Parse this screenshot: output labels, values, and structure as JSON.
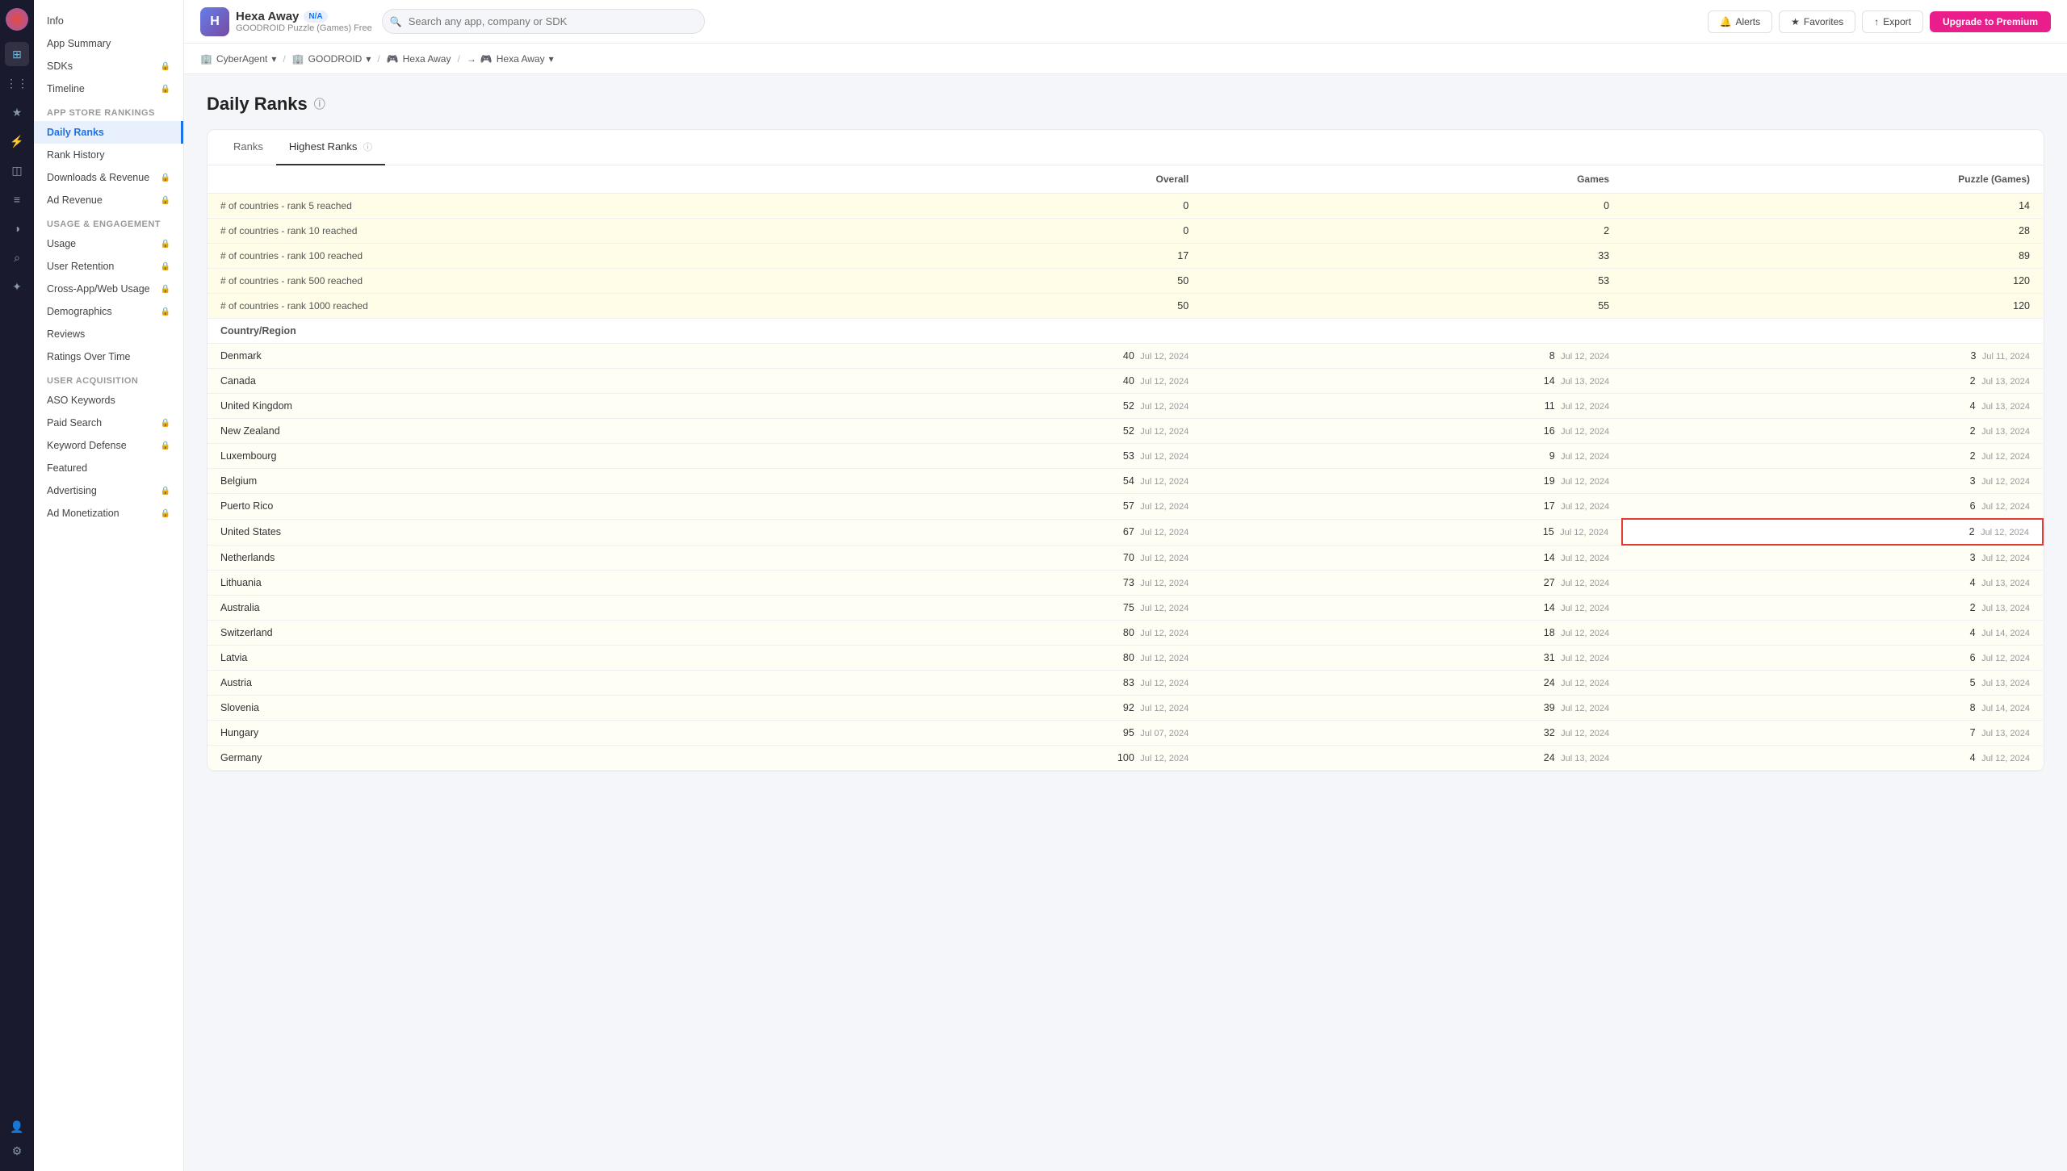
{
  "app": {
    "name": "Hexa Away",
    "sub": "GOODROID Puzzle (Games) Free",
    "na_label": "N/A",
    "icon_char": "H"
  },
  "topbar": {
    "search_placeholder": "Search any app, company or SDK",
    "alerts_label": "Alerts",
    "favorites_label": "Favorites",
    "export_label": "Export",
    "premium_label": "Upgrade to Premium"
  },
  "breadcrumbs": [
    {
      "label": "CyberAgent",
      "icon": "🏢"
    },
    {
      "label": "GOODROID",
      "icon": "🏢"
    },
    {
      "label": "Hexa Away",
      "icon": "🎮"
    },
    {
      "label": "Hexa Away",
      "icon": "🎮"
    }
  ],
  "sidebar": {
    "sections": [
      {
        "label": "",
        "items": [
          {
            "label": "Info",
            "lock": false,
            "active": false
          },
          {
            "label": "App Summary",
            "lock": false,
            "active": false
          }
        ]
      },
      {
        "label": "App Store Rankings",
        "items": [
          {
            "label": "Daily Ranks",
            "lock": false,
            "active": true
          },
          {
            "label": "Rank History",
            "lock": false,
            "active": false
          },
          {
            "label": "Downloads & Revenue",
            "lock": true,
            "active": false
          },
          {
            "label": "Ad Revenue",
            "lock": true,
            "active": false
          }
        ]
      },
      {
        "label": "Usage & Engagement",
        "items": [
          {
            "label": "Usage",
            "lock": true,
            "active": false
          },
          {
            "label": "User Retention",
            "lock": true,
            "active": false
          },
          {
            "label": "Cross-App/Web Usage",
            "lock": true,
            "active": false
          },
          {
            "label": "Demographics",
            "lock": true,
            "active": false
          },
          {
            "label": "Reviews",
            "lock": false,
            "active": false
          },
          {
            "label": "Ratings Over Time",
            "lock": false,
            "active": false
          }
        ]
      },
      {
        "label": "User Acquisition",
        "items": [
          {
            "label": "ASO Keywords",
            "lock": false,
            "active": false
          },
          {
            "label": "Paid Search",
            "lock": true,
            "active": false
          },
          {
            "label": "Keyword Defense",
            "lock": true,
            "active": false
          },
          {
            "label": "Featured",
            "lock": false,
            "active": false
          },
          {
            "label": "Advertising",
            "lock": true,
            "active": false
          },
          {
            "label": "Ad Monetization",
            "lock": true,
            "active": false
          }
        ]
      }
    ]
  },
  "page": {
    "title": "Daily Ranks",
    "tabs": [
      {
        "label": "Ranks",
        "active": false
      },
      {
        "label": "Highest Ranks",
        "active": true
      }
    ]
  },
  "table": {
    "columns": [
      {
        "label": "Overall"
      },
      {
        "label": "Games"
      },
      {
        "label": "Puzzle (Games)"
      }
    ],
    "summary_rows": [
      {
        "label": "# of countries - rank 5 reached",
        "overall": "0",
        "games": "0",
        "puzzle": "14"
      },
      {
        "label": "# of countries - rank 10 reached",
        "overall": "0",
        "games": "2",
        "puzzle": "28"
      },
      {
        "label": "# of countries - rank 100 reached",
        "overall": "17",
        "games": "33",
        "puzzle": "89"
      },
      {
        "label": "# of countries - rank 500 reached",
        "overall": "50",
        "games": "53",
        "puzzle": "120"
      },
      {
        "label": "# of countries - rank 1000 reached",
        "overall": "50",
        "games": "55",
        "puzzle": "120"
      }
    ],
    "section_label": "Country/Region",
    "country_rows": [
      {
        "country": "Denmark",
        "overall": "40",
        "overall_date": "Jul 12, 2024",
        "games": "8",
        "games_date": "Jul 12, 2024",
        "puzzle": "3",
        "puzzle_date": "Jul 11, 2024",
        "highlight": false
      },
      {
        "country": "Canada",
        "overall": "40",
        "overall_date": "Jul 12, 2024",
        "games": "14",
        "games_date": "Jul 13, 2024",
        "puzzle": "2",
        "puzzle_date": "Jul 13, 2024",
        "highlight": false
      },
      {
        "country": "United Kingdom",
        "overall": "52",
        "overall_date": "Jul 12, 2024",
        "games": "11",
        "games_date": "Jul 12, 2024",
        "puzzle": "4",
        "puzzle_date": "Jul 13, 2024",
        "highlight": false
      },
      {
        "country": "New Zealand",
        "overall": "52",
        "overall_date": "Jul 12, 2024",
        "games": "16",
        "games_date": "Jul 12, 2024",
        "puzzle": "2",
        "puzzle_date": "Jul 13, 2024",
        "highlight": false
      },
      {
        "country": "Luxembourg",
        "overall": "53",
        "overall_date": "Jul 12, 2024",
        "games": "9",
        "games_date": "Jul 12, 2024",
        "puzzle": "2",
        "puzzle_date": "Jul 12, 2024",
        "highlight": false
      },
      {
        "country": "Belgium",
        "overall": "54",
        "overall_date": "Jul 12, 2024",
        "games": "19",
        "games_date": "Jul 12, 2024",
        "puzzle": "3",
        "puzzle_date": "Jul 12, 2024",
        "highlight": false
      },
      {
        "country": "Puerto Rico",
        "overall": "57",
        "overall_date": "Jul 12, 2024",
        "games": "17",
        "games_date": "Jul 12, 2024",
        "puzzle": "6",
        "puzzle_date": "Jul 12, 2024",
        "highlight": false
      },
      {
        "country": "United States",
        "overall": "67",
        "overall_date": "Jul 12, 2024",
        "games": "15",
        "games_date": "Jul 12, 2024",
        "puzzle": "2",
        "puzzle_date": "Jul 12, 2024",
        "highlight": true
      },
      {
        "country": "Netherlands",
        "overall": "70",
        "overall_date": "Jul 12, 2024",
        "games": "14",
        "games_date": "Jul 12, 2024",
        "puzzle": "3",
        "puzzle_date": "Jul 12, 2024",
        "highlight": false
      },
      {
        "country": "Lithuania",
        "overall": "73",
        "overall_date": "Jul 12, 2024",
        "games": "27",
        "games_date": "Jul 12, 2024",
        "puzzle": "4",
        "puzzle_date": "Jul 13, 2024",
        "highlight": false
      },
      {
        "country": "Australia",
        "overall": "75",
        "overall_date": "Jul 12, 2024",
        "games": "14",
        "games_date": "Jul 12, 2024",
        "puzzle": "2",
        "puzzle_date": "Jul 13, 2024",
        "highlight": false
      },
      {
        "country": "Switzerland",
        "overall": "80",
        "overall_date": "Jul 12, 2024",
        "games": "18",
        "games_date": "Jul 12, 2024",
        "puzzle": "4",
        "puzzle_date": "Jul 14, 2024",
        "highlight": false
      },
      {
        "country": "Latvia",
        "overall": "80",
        "overall_date": "Jul 12, 2024",
        "games": "31",
        "games_date": "Jul 12, 2024",
        "puzzle": "6",
        "puzzle_date": "Jul 12, 2024",
        "highlight": false
      },
      {
        "country": "Austria",
        "overall": "83",
        "overall_date": "Jul 12, 2024",
        "games": "24",
        "games_date": "Jul 12, 2024",
        "puzzle": "5",
        "puzzle_date": "Jul 13, 2024",
        "highlight": false
      },
      {
        "country": "Slovenia",
        "overall": "92",
        "overall_date": "Jul 12, 2024",
        "games": "39",
        "games_date": "Jul 12, 2024",
        "puzzle": "8",
        "puzzle_date": "Jul 14, 2024",
        "highlight": false
      },
      {
        "country": "Hungary",
        "overall": "95",
        "overall_date": "Jul 07, 2024",
        "games": "32",
        "games_date": "Jul 12, 2024",
        "puzzle": "7",
        "puzzle_date": "Jul 13, 2024",
        "highlight": false
      },
      {
        "country": "Germany",
        "overall": "100",
        "overall_date": "Jul 12, 2024",
        "games": "24",
        "games_date": "Jul 13, 2024",
        "puzzle": "4",
        "puzzle_date": "Jul 12, 2024",
        "highlight": false
      }
    ]
  }
}
